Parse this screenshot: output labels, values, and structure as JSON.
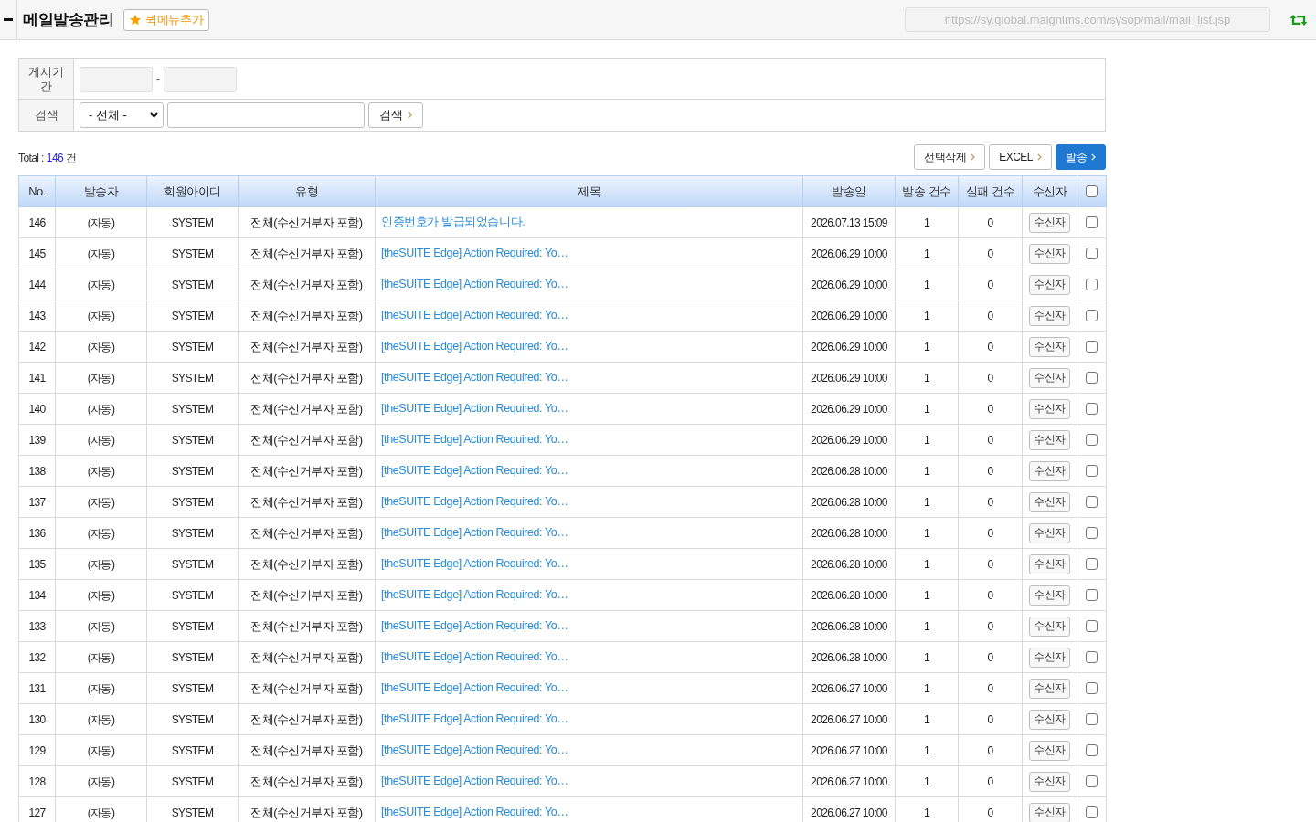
{
  "header": {
    "title": "메일발송관리",
    "quick_menu_button": "퀵메뉴추가",
    "url": "https://sy.global.malgnlms.com/sysop/mail/mail_list.jsp"
  },
  "search_form": {
    "rows": [
      {
        "kind": "date_range",
        "label": "게시기간",
        "separator": "-"
      },
      {
        "kind": "search",
        "label": "검색",
        "select_value": "- 전체 -",
        "button": "검색"
      }
    ]
  },
  "total": {
    "label": "Total :",
    "count": "146",
    "unit": "건"
  },
  "actions": [
    {
      "label": "선택삭제",
      "kind": "default"
    },
    {
      "label": "EXCEL",
      "kind": "default"
    },
    {
      "label": "발송",
      "kind": "primary"
    }
  ],
  "table": {
    "columns": [
      "No.",
      "발송자",
      "회원아이디",
      "유형",
      "제목",
      "발송일",
      "발송 건수",
      "실패 건수",
      "수신자"
    ],
    "header_checkbox": {
      "checked": false
    },
    "rows": [
      {
        "no": "146",
        "sender": "(자동)",
        "member_id": "SYSTEM",
        "type": "전체(수신거부자 포함)",
        "subject": "인증번호가 발급되었습니다.",
        "sent_at": "2026.07.13 15:09",
        "sent_count": "1",
        "failed_count": "0",
        "recipients_button": "수신자",
        "checked": false
      },
      {
        "no": "145",
        "sender": "(자동)",
        "member_id": "SYSTEM",
        "type": "전체(수신거부자 포함)",
        "subject": "[theSUITE Edge] Action Required: Yo…",
        "sent_at": "2026.06.29 10:00",
        "sent_count": "1",
        "failed_count": "0",
        "recipients_button": "수신자",
        "checked": false
      },
      {
        "no": "144",
        "sender": "(자동)",
        "member_id": "SYSTEM",
        "type": "전체(수신거부자 포함)",
        "subject": "[theSUITE Edge] Action Required: Yo…",
        "sent_at": "2026.06.29 10:00",
        "sent_count": "1",
        "failed_count": "0",
        "recipients_button": "수신자",
        "checked": false
      },
      {
        "no": "143",
        "sender": "(자동)",
        "member_id": "SYSTEM",
        "type": "전체(수신거부자 포함)",
        "subject": "[theSUITE Edge] Action Required: Yo…",
        "sent_at": "2026.06.29 10:00",
        "sent_count": "1",
        "failed_count": "0",
        "recipients_button": "수신자",
        "checked": false
      },
      {
        "no": "142",
        "sender": "(자동)",
        "member_id": "SYSTEM",
        "type": "전체(수신거부자 포함)",
        "subject": "[theSUITE Edge] Action Required: Yo…",
        "sent_at": "2026.06.29 10:00",
        "sent_count": "1",
        "failed_count": "0",
        "recipients_button": "수신자",
        "checked": false
      },
      {
        "no": "141",
        "sender": "(자동)",
        "member_id": "SYSTEM",
        "type": "전체(수신거부자 포함)",
        "subject": "[theSUITE Edge] Action Required: Yo…",
        "sent_at": "2026.06.29 10:00",
        "sent_count": "1",
        "failed_count": "0",
        "recipients_button": "수신자",
        "checked": false
      },
      {
        "no": "140",
        "sender": "(자동)",
        "member_id": "SYSTEM",
        "type": "전체(수신거부자 포함)",
        "subject": "[theSUITE Edge] Action Required: Yo…",
        "sent_at": "2026.06.29 10:00",
        "sent_count": "1",
        "failed_count": "0",
        "recipients_button": "수신자",
        "checked": false
      },
      {
        "no": "139",
        "sender": "(자동)",
        "member_id": "SYSTEM",
        "type": "전체(수신거부자 포함)",
        "subject": "[theSUITE Edge] Action Required: Yo…",
        "sent_at": "2026.06.29 10:00",
        "sent_count": "1",
        "failed_count": "0",
        "recipients_button": "수신자",
        "checked": false
      },
      {
        "no": "138",
        "sender": "(자동)",
        "member_id": "SYSTEM",
        "type": "전체(수신거부자 포함)",
        "subject": "[theSUITE Edge] Action Required: Yo…",
        "sent_at": "2026.06.28 10:00",
        "sent_count": "1",
        "failed_count": "0",
        "recipients_button": "수신자",
        "checked": false
      },
      {
        "no": "137",
        "sender": "(자동)",
        "member_id": "SYSTEM",
        "type": "전체(수신거부자 포함)",
        "subject": "[theSUITE Edge] Action Required: Yo…",
        "sent_at": "2026.06.28 10:00",
        "sent_count": "1",
        "failed_count": "0",
        "recipients_button": "수신자",
        "checked": false
      },
      {
        "no": "136",
        "sender": "(자동)",
        "member_id": "SYSTEM",
        "type": "전체(수신거부자 포함)",
        "subject": "[theSUITE Edge] Action Required: Yo…",
        "sent_at": "2026.06.28 10:00",
        "sent_count": "1",
        "failed_count": "0",
        "recipients_button": "수신자",
        "checked": false
      },
      {
        "no": "135",
        "sender": "(자동)",
        "member_id": "SYSTEM",
        "type": "전체(수신거부자 포함)",
        "subject": "[theSUITE Edge] Action Required: Yo…",
        "sent_at": "2026.06.28 10:00",
        "sent_count": "1",
        "failed_count": "0",
        "recipients_button": "수신자",
        "checked": false
      },
      {
        "no": "134",
        "sender": "(자동)",
        "member_id": "SYSTEM",
        "type": "전체(수신거부자 포함)",
        "subject": "[theSUITE Edge] Action Required: Yo…",
        "sent_at": "2026.06.28 10:00",
        "sent_count": "1",
        "failed_count": "0",
        "recipients_button": "수신자",
        "checked": false
      },
      {
        "no": "133",
        "sender": "(자동)",
        "member_id": "SYSTEM",
        "type": "전체(수신거부자 포함)",
        "subject": "[theSUITE Edge] Action Required: Yo…",
        "sent_at": "2026.06.28 10:00",
        "sent_count": "1",
        "failed_count": "0",
        "recipients_button": "수신자",
        "checked": false
      },
      {
        "no": "132",
        "sender": "(자동)",
        "member_id": "SYSTEM",
        "type": "전체(수신거부자 포함)",
        "subject": "[theSUITE Edge] Action Required: Yo…",
        "sent_at": "2026.06.28 10:00",
        "sent_count": "1",
        "failed_count": "0",
        "recipients_button": "수신자",
        "checked": false
      },
      {
        "no": "131",
        "sender": "(자동)",
        "member_id": "SYSTEM",
        "type": "전체(수신거부자 포함)",
        "subject": "[theSUITE Edge] Action Required: Yo…",
        "sent_at": "2026.06.27 10:00",
        "sent_count": "1",
        "failed_count": "0",
        "recipients_button": "수신자",
        "checked": false
      },
      {
        "no": "130",
        "sender": "(자동)",
        "member_id": "SYSTEM",
        "type": "전체(수신거부자 포함)",
        "subject": "[theSUITE Edge] Action Required: Yo…",
        "sent_at": "2026.06.27 10:00",
        "sent_count": "1",
        "failed_count": "0",
        "recipients_button": "수신자",
        "checked": false
      },
      {
        "no": "129",
        "sender": "(자동)",
        "member_id": "SYSTEM",
        "type": "전체(수신거부자 포함)",
        "subject": "[theSUITE Edge] Action Required: Yo…",
        "sent_at": "2026.06.27 10:00",
        "sent_count": "1",
        "failed_count": "0",
        "recipients_button": "수신자",
        "checked": false
      },
      {
        "no": "128",
        "sender": "(자동)",
        "member_id": "SYSTEM",
        "type": "전체(수신거부자 포함)",
        "subject": "[theSUITE Edge] Action Required: Yo…",
        "sent_at": "2026.06.27 10:00",
        "sent_count": "1",
        "failed_count": "0",
        "recipients_button": "수신자",
        "checked": false
      },
      {
        "no": "127",
        "sender": "(자동)",
        "member_id": "SYSTEM",
        "type": "전체(수신거부자 포함)",
        "subject": "[theSUITE Edge] Action Required: Yo…",
        "sent_at": "2026.06.27 10:00",
        "sent_count": "1",
        "failed_count": "0",
        "recipients_button": "수신자",
        "checked": false
      }
    ]
  }
}
